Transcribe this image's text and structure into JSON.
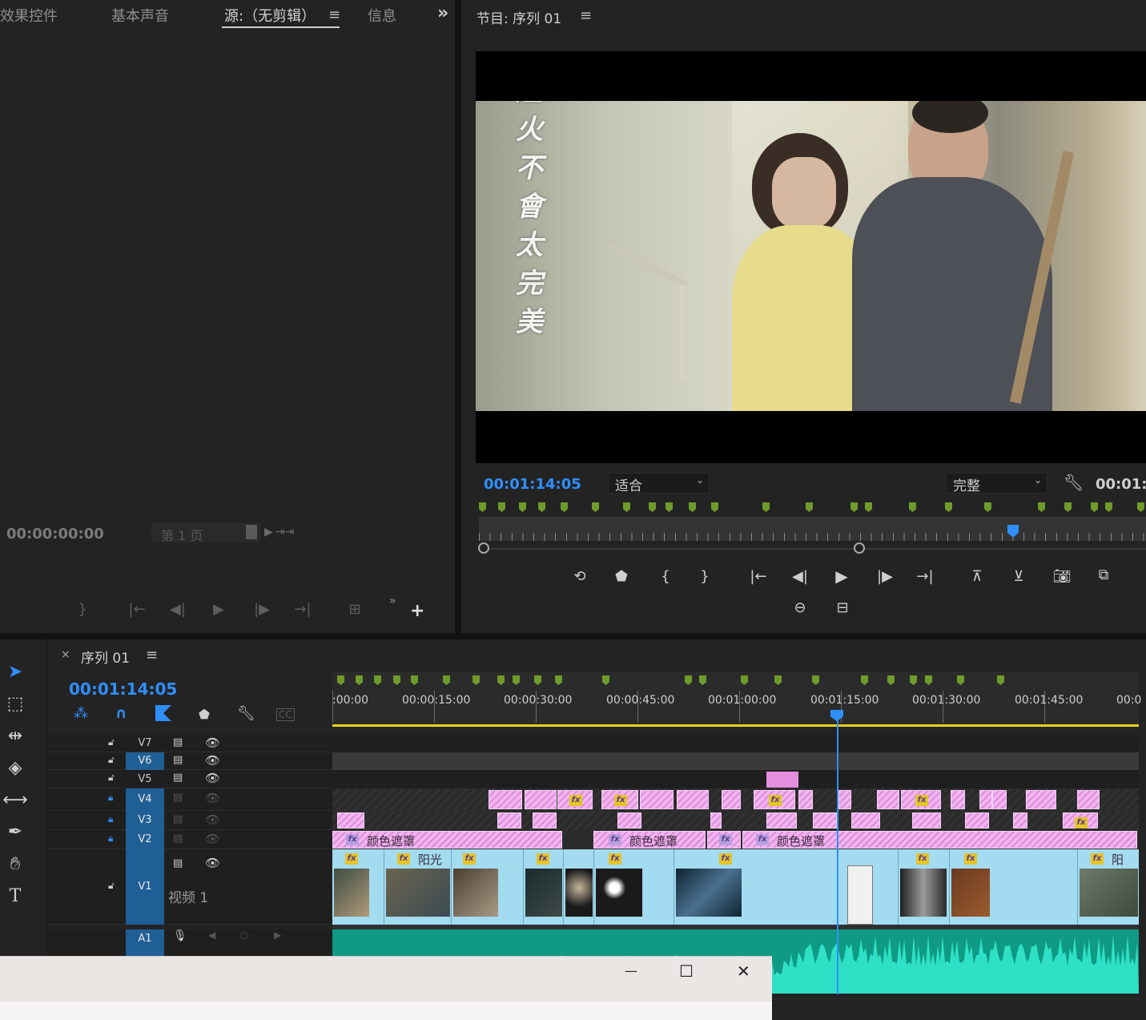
{
  "source_panel": {
    "tabs": [
      {
        "label": "效果控件"
      },
      {
        "label": "基本声音"
      },
      {
        "label": "源:（无剪辑）"
      },
      {
        "label": "信息"
      }
    ],
    "menu_glyph": "≡",
    "overflow_glyph": "»",
    "timecode": "00:00:00:00",
    "page_label": "第 1 页",
    "controls": [
      "mark-out",
      "go-to-in",
      "step-back",
      "play",
      "step-forward",
      "go-to-out",
      "export-frame",
      "add"
    ]
  },
  "program_panel": {
    "title": "节目: 序列 01",
    "menu_glyph": "≡",
    "timecode": "00:01:14:05",
    "fit_value": "适合",
    "quality_value": "完整",
    "right_timecode": "00:01:",
    "video_title_chars": [
      "煙",
      "火",
      "不",
      "會",
      "太",
      "完",
      "美"
    ]
  },
  "timeline": {
    "close_glyph": "×",
    "sequence_name": "序列 01",
    "menu_glyph": "≡",
    "timecode": "00:01:14:05",
    "ruler_labels": [
      ":00:00",
      "00:00:15:00",
      "00:00:30:00",
      "00:00:45:00",
      "00:01:00:00",
      "00:01:15:00",
      "00:01:30:00",
      "00:01:45:00",
      "00:0"
    ],
    "tracks": {
      "v7": "V7",
      "v6": "V6",
      "v5": "V5",
      "v4": "V4",
      "v3": "V3",
      "v2": "V2",
      "v1": "V1",
      "a1": "A1"
    },
    "v1_name": "视频 1",
    "v2_clip_labels": [
      "颜色遮罩",
      "颜色遮罩",
      "颜色遮罩"
    ],
    "v1_clip_labels": [
      "阳光",
      "阳"
    ],
    "fx_label": "fx"
  },
  "dialog": {
    "minimize_glyph": "—",
    "maximize_glyph": "☐",
    "close_glyph": "✕"
  },
  "colors": {
    "accent_blue": "#2f8fff",
    "marker_green": "#6e9b29",
    "clip_pink": "#f4b3f2",
    "clip_blue": "#a3dbf0",
    "audio_teal": "#2ee0c5",
    "fx_yellow": "#e5c42a"
  }
}
